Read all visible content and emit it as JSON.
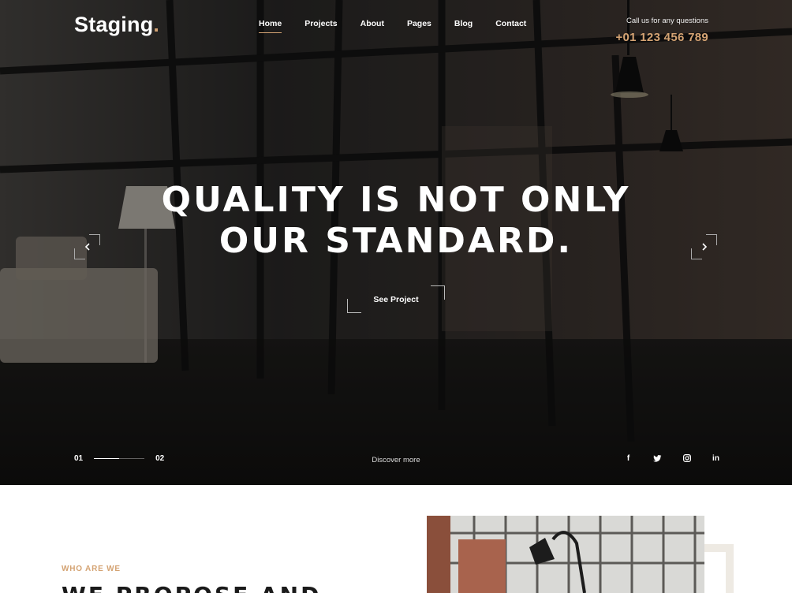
{
  "brand": {
    "name": "Staging",
    "dot": ".",
    "accent": "#d4a373"
  },
  "nav": {
    "items": [
      {
        "label": "Home",
        "active": true
      },
      {
        "label": "Projects"
      },
      {
        "label": "About"
      },
      {
        "label": "Pages"
      },
      {
        "label": "Blog"
      },
      {
        "label": "Contact"
      }
    ]
  },
  "contact": {
    "prompt": "Call us for any questions",
    "phone": "+01 123 456 789"
  },
  "hero": {
    "headline_line1": "QUALITY IS NOT ONLY",
    "headline_line2": "OUR STANDARD.",
    "cta_label": "See Project",
    "prev_icon": "chevron-left-icon",
    "next_icon": "chevron-right-icon",
    "discover_label": "Discover more"
  },
  "slider": {
    "current": "01",
    "total": "02",
    "progress": 0.5
  },
  "social": [
    {
      "name": "facebook-icon",
      "glyph": "f"
    },
    {
      "name": "twitter-icon",
      "glyph": "t"
    },
    {
      "name": "instagram-icon",
      "glyph": "ig"
    },
    {
      "name": "linkedin-icon",
      "glyph": "in"
    }
  ],
  "about": {
    "eyebrow": "WHO ARE WE",
    "title": "WE PROPOSE AND"
  }
}
